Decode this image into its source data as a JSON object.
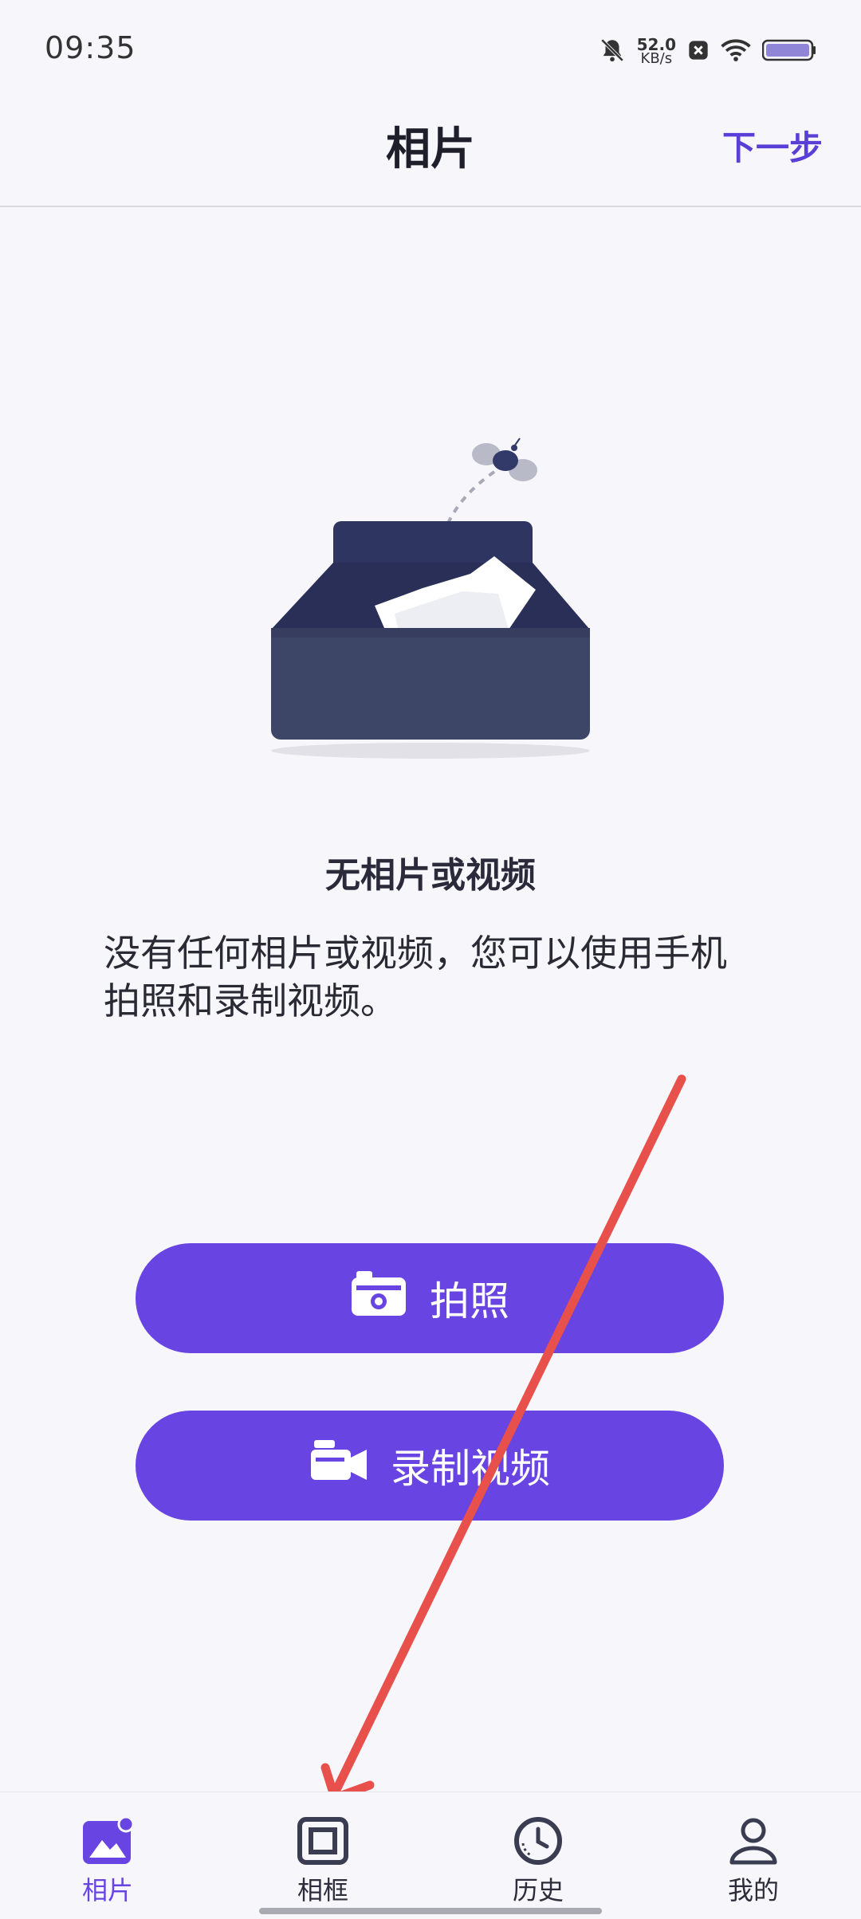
{
  "status_bar": {
    "time": "09:35",
    "net_speed_value": "52.0",
    "net_speed_unit": "KB/s",
    "icons": [
      "bell-muted-icon",
      "close-box-icon",
      "wifi-icon",
      "battery-icon"
    ]
  },
  "header": {
    "title": "相片",
    "next_label": "下一步"
  },
  "empty_state": {
    "title": "无相片或视频",
    "description": "没有任何相片或视频，您可以使用手机拍照和录制视频。"
  },
  "actions": {
    "take_photo_label": "拍照",
    "record_video_label": "录制视频"
  },
  "bottom_nav": {
    "items": [
      {
        "label": "相片",
        "icon": "photo-icon",
        "active": true
      },
      {
        "label": "相框",
        "icon": "frame-icon",
        "active": false
      },
      {
        "label": "历史",
        "icon": "history-clock-icon",
        "active": false
      },
      {
        "label": "我的",
        "icon": "profile-icon",
        "active": false
      }
    ]
  },
  "colors": {
    "accent": "#6845e3",
    "background": "#f7f6fb",
    "annotation_arrow": "#e8504c"
  }
}
